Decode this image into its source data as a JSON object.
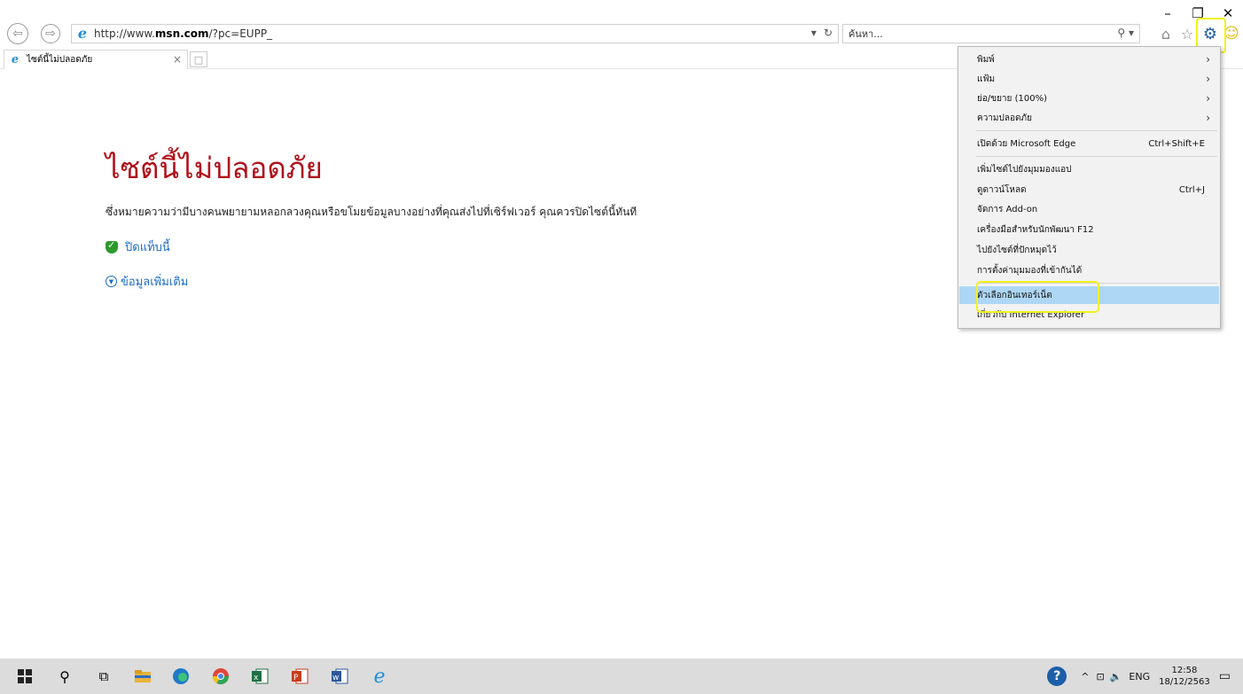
{
  "window": {
    "minimize": "–",
    "restore": "❐",
    "close": "✕"
  },
  "nav": {
    "back_glyph": "⇦",
    "forward_glyph": "⇨",
    "url_prefix": "http://www.",
    "url_domain": "msn.com",
    "url_suffix": "/?pc=EUPP_",
    "addr_dropdown": "▾",
    "refresh_glyph": "↻",
    "search_placeholder": "ค้นหา...",
    "search_tools": "⚲ ▾",
    "icons": [
      "back-icon",
      "forward-icon",
      "ie-logo-icon",
      "refresh-icon",
      "search-icon",
      "home-icon",
      "favorites-star-icon",
      "gear-icon",
      "smiley-icon"
    ]
  },
  "toolbar": {
    "home_glyph": "⌂",
    "star_glyph": "☆",
    "gear_glyph": "⚙",
    "smiley_glyph": "☺"
  },
  "tab": {
    "title": "ไซต์นี้ไม่ปลอดภัย",
    "close_glyph": "×",
    "new_tab_glyph": "□"
  },
  "content": {
    "title": "ไซต์นี้ไม่ปลอดภัย",
    "description": "ซึ่งหมายความว่ามีบางคนพยายามหลอกลวงคุณหรือขโมยข้อมูลบางอย่างที่คุณส่งไปที่เซิร์ฟเวอร์ คุณควรปิดไซต์นี้ทันที",
    "close_tab_link": "ปิดแท็บนี้",
    "more_info_link": "ข้อมูลเพิ่มเติม"
  },
  "menu": {
    "items": [
      {
        "label": "พิมพ์",
        "right": "",
        "submenu": true
      },
      {
        "label": "แฟ้ม",
        "right": "",
        "submenu": true
      },
      {
        "label": "ย่อ/ขยาย (100%)",
        "right": "",
        "submenu": true
      },
      {
        "label": "ความปลอดภัย",
        "right": "",
        "submenu": true
      },
      {
        "label": "เปิดด้วย Microsoft Edge",
        "right": "Ctrl+Shift+E",
        "submenu": false
      },
      {
        "label": "เพิ่มไซต์ไปยังมุมมองแอป",
        "right": "",
        "submenu": false
      },
      {
        "label": "ดูดาวน์โหลด",
        "right": "Ctrl+J",
        "submenu": false
      },
      {
        "label": "จัดการ Add-on",
        "right": "",
        "submenu": false
      },
      {
        "label": "เครื่องมือสำหรับนักพัฒนา F12",
        "right": "",
        "submenu": false
      },
      {
        "label": "ไปยังไซต์ที่ปักหมุดไว้",
        "right": "",
        "submenu": false
      },
      {
        "label": "การตั้งค่ามุมมองที่เข้ากันได้",
        "right": "",
        "submenu": false
      },
      {
        "label": "ตัวเลือกอินเทอร์เน็ต",
        "right": "",
        "submenu": false,
        "highlighted": true
      },
      {
        "label": "เกี่ยวกับ Internet Explorer",
        "right": "",
        "submenu": false
      }
    ],
    "arrow_glyph": "›"
  },
  "taskbar": {
    "apps": [
      "windows-start-icon",
      "search-icon",
      "task-view-icon",
      "file-explorer-icon",
      "edge-icon",
      "chrome-icon",
      "excel-icon",
      "powerpoint-icon",
      "word-icon",
      "internet-explorer-icon"
    ],
    "search_glyph": "⚲",
    "taskview_glyph": "⧉",
    "help_glyph": "?",
    "tray_caret": "^",
    "network_glyph": "⊡",
    "volume_glyph": "🔈",
    "language": "ENG",
    "time": "12:58",
    "date": "18/12/2563",
    "notification_glyph": "▭"
  },
  "colors": {
    "title_red": "#b0111a",
    "link_blue": "#1a6bc4",
    "menu_highlight": "#aed7f5",
    "annotation_yellow": "#f2f21a"
  }
}
